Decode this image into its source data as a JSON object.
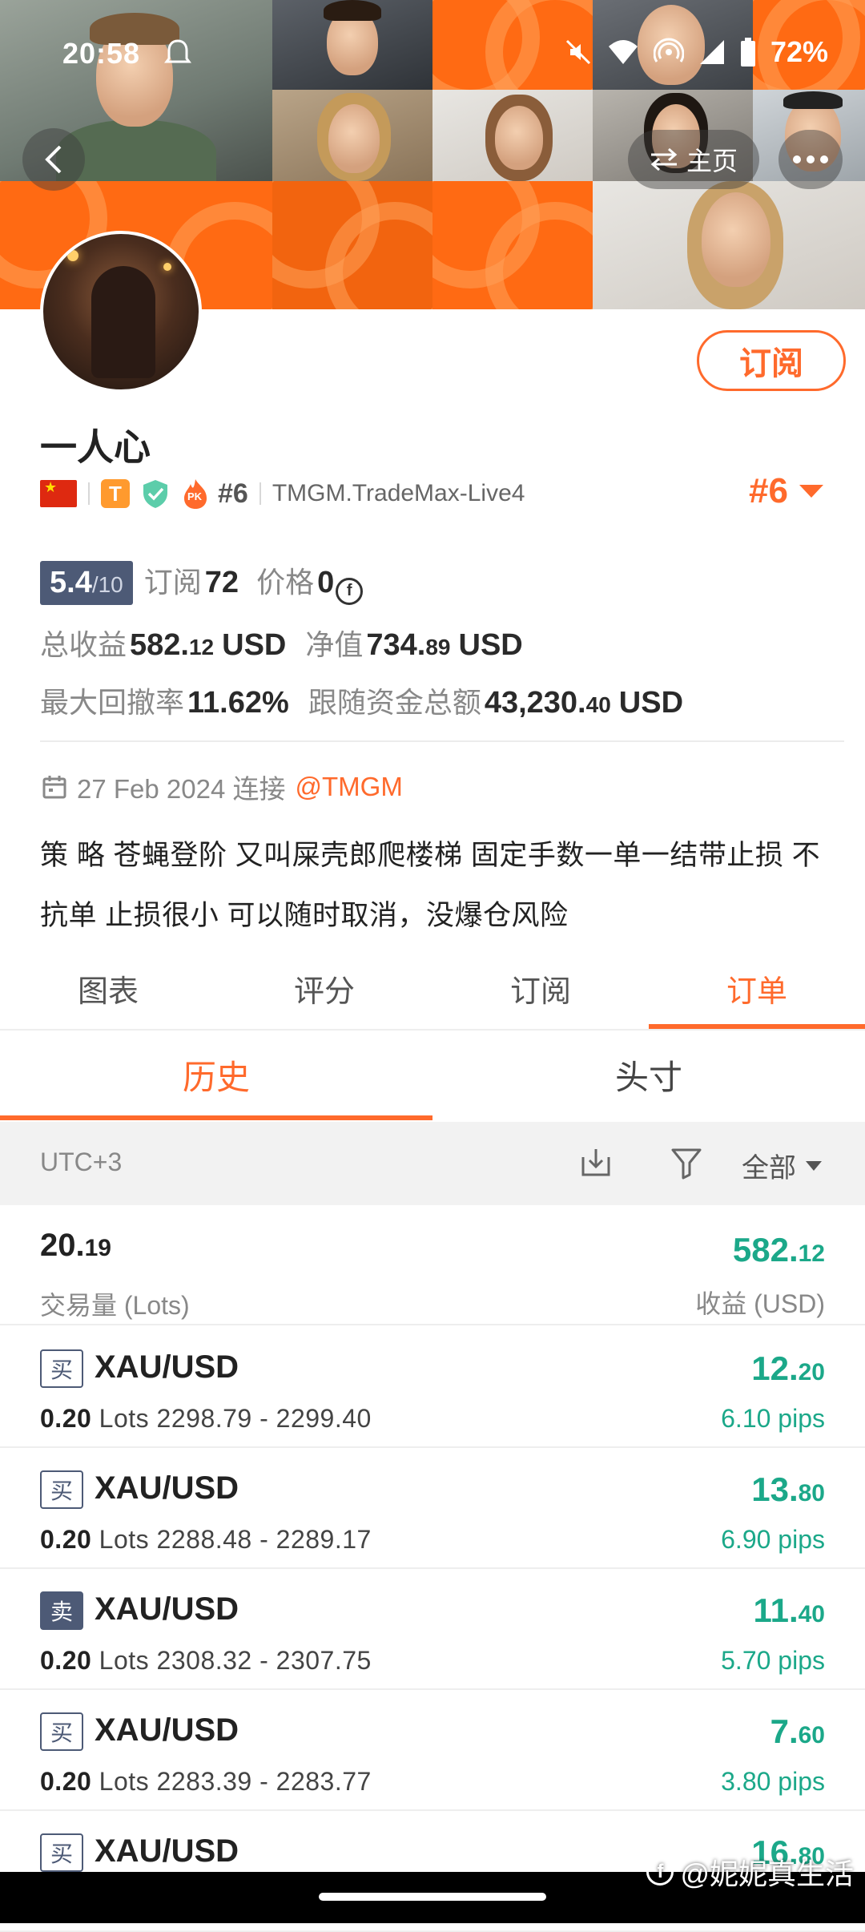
{
  "status_bar": {
    "time": "20:58",
    "battery": "72%"
  },
  "nav": {
    "home_label": "主页"
  },
  "profile": {
    "name": "一人心",
    "subscribe_label": "订阅",
    "rank_badge": "#6",
    "server": "TMGM.TradeMax-Live4",
    "rank_right": "#6",
    "badge_t": "T",
    "badge_pk": "PK"
  },
  "stats": {
    "score": "5.4",
    "score_den": "/10",
    "subscribers_label": "订阅",
    "subscribers": "72",
    "price_label": "价格",
    "price": "0",
    "total_profit_label": "总收益",
    "total_profit_int": "582.",
    "total_profit_dec": "12",
    "total_profit_unit": "USD",
    "net_value_label": "净值",
    "net_value_int": "734.",
    "net_value_dec": "89",
    "net_value_unit": "USD",
    "max_drawdown_label": "最大回撤率",
    "max_drawdown": "11.62%",
    "follow_funds_label": "跟随资金总额",
    "follow_funds_int": "43,230.",
    "follow_funds_dec": "40",
    "follow_funds_unit": "USD"
  },
  "connect": {
    "date": "27 Feb 2024 连接",
    "broker": "@TMGM"
  },
  "description": "策 略 苍蝇登阶 又叫屎壳郎爬楼梯 固定手数一单一结带止损 不抗单 止损很小 可以随时取消，没爆仓风险",
  "tabs": [
    "图表",
    "评分",
    "订阅",
    "订单"
  ],
  "subtabs": [
    "历史",
    "头寸"
  ],
  "filter": {
    "timezone": "UTC+3",
    "select_value": "全部"
  },
  "summary": {
    "volume_int": "20.",
    "volume_dec": "19",
    "volume_label": "交易量 (Lots)",
    "profit_int": "582.",
    "profit_dec": "12",
    "profit_label": "收益 (USD)"
  },
  "orders": [
    {
      "type": "买",
      "symbol": "XAU/USD",
      "lots": "0.20",
      "lots_unit": "Lots",
      "prices": "2298.79 - 2299.40",
      "profit_int": "12.",
      "profit_dec": "20",
      "pips": "6.10 pips"
    },
    {
      "type": "买",
      "symbol": "XAU/USD",
      "lots": "0.20",
      "lots_unit": "Lots",
      "prices": "2288.48 - 2289.17",
      "profit_int": "13.",
      "profit_dec": "80",
      "pips": "6.90 pips"
    },
    {
      "type": "卖",
      "symbol": "XAU/USD",
      "lots": "0.20",
      "lots_unit": "Lots",
      "prices": "2308.32 - 2307.75",
      "profit_int": "11.",
      "profit_dec": "40",
      "pips": "5.70 pips"
    },
    {
      "type": "买",
      "symbol": "XAU/USD",
      "lots": "0.20",
      "lots_unit": "Lots",
      "prices": "2283.39 - 2283.77",
      "profit_int": "7.",
      "profit_dec": "60",
      "pips": "3.80 pips"
    },
    {
      "type": "买",
      "symbol": "XAU/USD",
      "profit_int": "16.",
      "profit_dec": "80"
    }
  ],
  "watermark": "@妮妮真生活",
  "colors": {
    "accent": "#ff6a2c",
    "profit": "#1ba889",
    "badge": "#4d5a76"
  }
}
